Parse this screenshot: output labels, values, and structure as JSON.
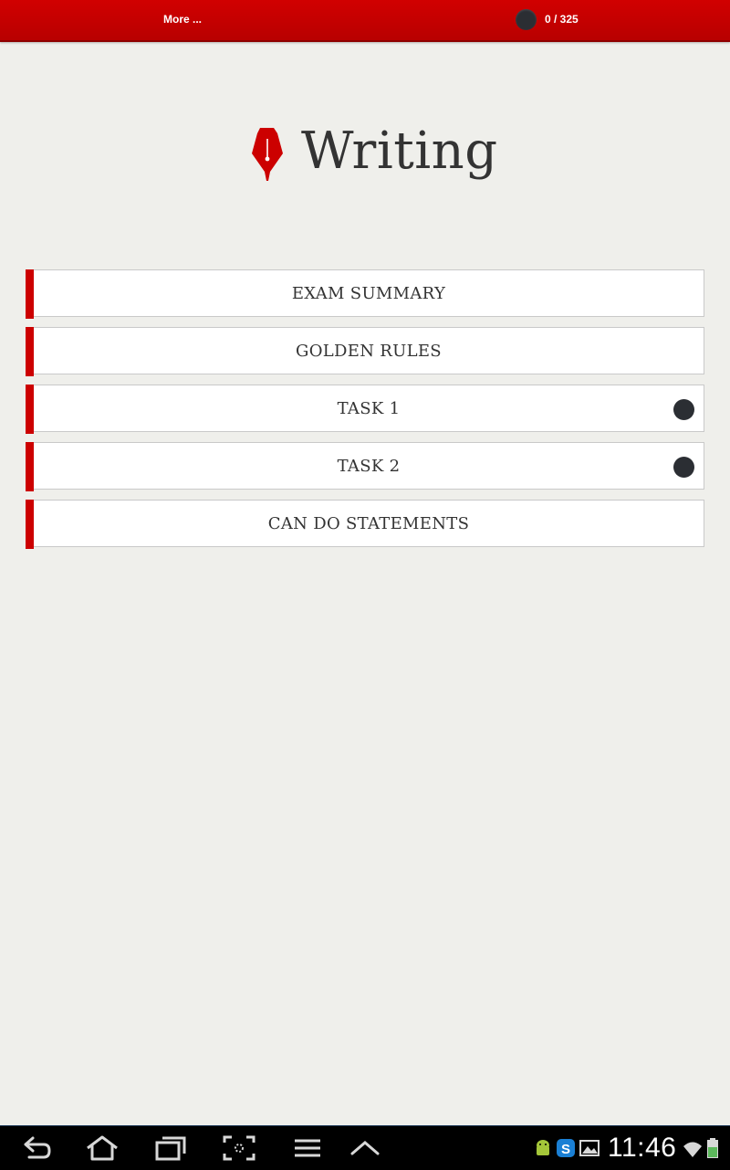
{
  "topbar": {
    "more_label": "More ...",
    "progress_count": "0 / 325"
  },
  "header": {
    "title": "Writing",
    "icon": "fountain-pen-nib-icon",
    "accent_color": "#cc0000"
  },
  "menu": {
    "items": [
      {
        "label": "EXAM SUMMARY",
        "has_status": false
      },
      {
        "label": "GOLDEN RULES",
        "has_status": false
      },
      {
        "label": "TASK 1",
        "has_status": true
      },
      {
        "label": "TASK 2",
        "has_status": true
      },
      {
        "label": "CAN DO STATEMENTS",
        "has_status": false
      }
    ]
  },
  "system_bar": {
    "time": "11:46",
    "nav_icons": [
      "back-icon",
      "home-icon",
      "recent-apps-icon",
      "screenshot-icon",
      "menu-icon",
      "up-chevron-icon"
    ],
    "notification_icons": [
      "android-debug-icon",
      "skype-icon",
      "gallery-icon"
    ],
    "status_icons": [
      "wifi-icon",
      "battery-icon"
    ]
  }
}
